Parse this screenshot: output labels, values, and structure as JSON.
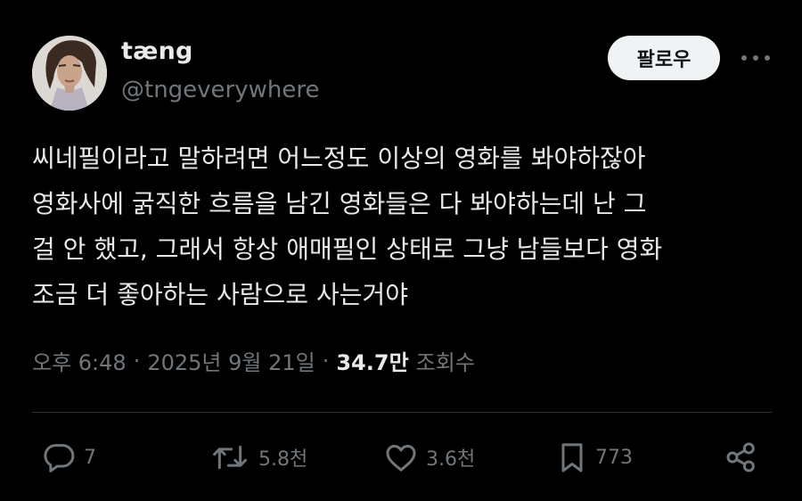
{
  "author": {
    "display_name": "tæng",
    "handle": "@tngeverywhere"
  },
  "follow_button": {
    "label": "팔로우"
  },
  "tweet": {
    "lines": [
      "씨네필이라고 말하려면 어느정도 이상의 영화를 봐야하잖아",
      "영화사에 굵직한 흐름을 남긴 영화들은 다 봐야하는데 난 그",
      "걸 안 했고, 그래서 항상 애매필인 상태로 그냥 남들보다 영화",
      "조금 더 좋아하는 사람으로 사는거야"
    ]
  },
  "meta": {
    "time": "오후 6:48",
    "separator": "·",
    "date": "2025년 9월 21일",
    "views_count": "34.7만",
    "views_label": "조회수"
  },
  "actions": {
    "replies": "7",
    "reposts": "5.8천",
    "likes": "3.6천",
    "bookmarks": "773"
  },
  "icons": {
    "avatar": "avatar-photo",
    "more": "more-dots-icon",
    "reply": "reply-icon",
    "repost": "repost-icon",
    "like": "heart-icon",
    "bookmark": "bookmark-icon",
    "share": "share-icon"
  },
  "colors": {
    "background": "#000000",
    "text_primary": "#e7e9ea",
    "text_secondary": "#71767b",
    "follow_button_bg": "#eff3f4",
    "divider": "#2f3336"
  }
}
